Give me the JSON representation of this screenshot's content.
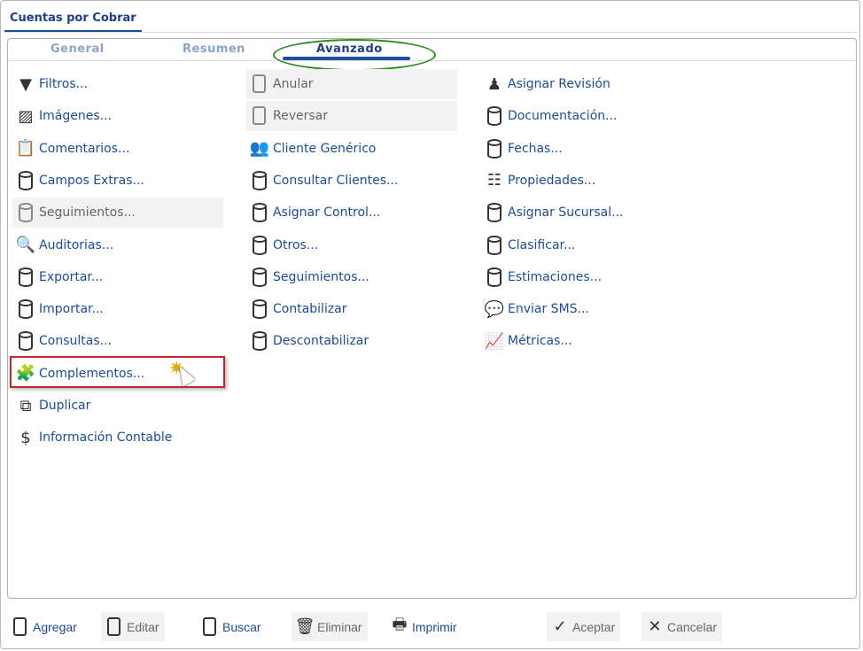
{
  "window": {
    "tab": "Cuentas por Cobrar"
  },
  "subtabs": [
    "General",
    "Resumen",
    "Avanzado"
  ],
  "active_subtab": "Avanzado",
  "columns": [
    [
      {
        "label": "Filtros...",
        "icon": "filter-icon"
      },
      {
        "label": "Imágenes...",
        "icon": "image-icon"
      },
      {
        "label": "Comentarios...",
        "icon": "clipboard-edit-icon"
      },
      {
        "label": "Campos Extras...",
        "icon": "database-icon"
      },
      {
        "label": "Seguimientos...",
        "icon": "database-icon",
        "disabled": true
      },
      {
        "label": "Auditorias...",
        "icon": "audit-search-icon"
      },
      {
        "label": "Exportar...",
        "icon": "database-export-icon"
      },
      {
        "label": "Importar...",
        "icon": "database-import-icon"
      },
      {
        "label": "Consultas...",
        "icon": "database-icon"
      },
      {
        "label": "Complementos...",
        "icon": "puzzle-icon",
        "highlighted": true
      },
      {
        "label": "Duplicar",
        "icon": "copy-icon"
      },
      {
        "label": "Información Contable",
        "icon": "dollar-icon"
      }
    ],
    [
      {
        "label": "Anular",
        "icon": "document-cancel-icon",
        "disabled": true
      },
      {
        "label": "Reversar",
        "icon": "document-undo-icon",
        "disabled": true
      },
      {
        "label": "Cliente Genérico",
        "icon": "users-icon"
      },
      {
        "label": "Consultar Clientes...",
        "icon": "database-icon"
      },
      {
        "label": "Asignar Control...",
        "icon": "database-icon"
      },
      {
        "label": "Otros...",
        "icon": "database-icon"
      },
      {
        "label": "Seguimientos...",
        "icon": "database-icon"
      },
      {
        "label": "Contabilizar",
        "icon": "database-icon"
      },
      {
        "label": "Descontabilizar",
        "icon": "database-icon"
      }
    ],
    [
      {
        "label": "Asignar Revisión",
        "icon": "stamp-icon"
      },
      {
        "label": "Documentación...",
        "icon": "database-icon"
      },
      {
        "label": "Fechas...",
        "icon": "database-icon"
      },
      {
        "label": "Propiedades...",
        "icon": "properties-list-icon"
      },
      {
        "label": "Asignar Sucursal...",
        "icon": "database-icon"
      },
      {
        "label": "Clasificar...",
        "icon": "database-icon"
      },
      {
        "label": "Estimaciones...",
        "icon": "database-icon"
      },
      {
        "label": "Enviar SMS...",
        "icon": "sms-icon"
      },
      {
        "label": "Métricas...",
        "icon": "metrics-icon"
      }
    ]
  ],
  "toolbar": [
    {
      "label": "Agregar",
      "icon": "add-document-icon"
    },
    {
      "label": "Editar",
      "icon": "edit-document-icon",
      "disabled": true
    },
    {
      "label": "Buscar",
      "icon": "search-document-icon"
    },
    {
      "label": "Eliminar",
      "icon": "trash-icon",
      "disabled": true
    },
    {
      "label": "Imprimir",
      "icon": "printer-icon"
    },
    {
      "label": "Aceptar",
      "icon": "check-icon",
      "disabled": true
    },
    {
      "label": "Cancelar",
      "icon": "close-icon",
      "disabled": true
    }
  ]
}
